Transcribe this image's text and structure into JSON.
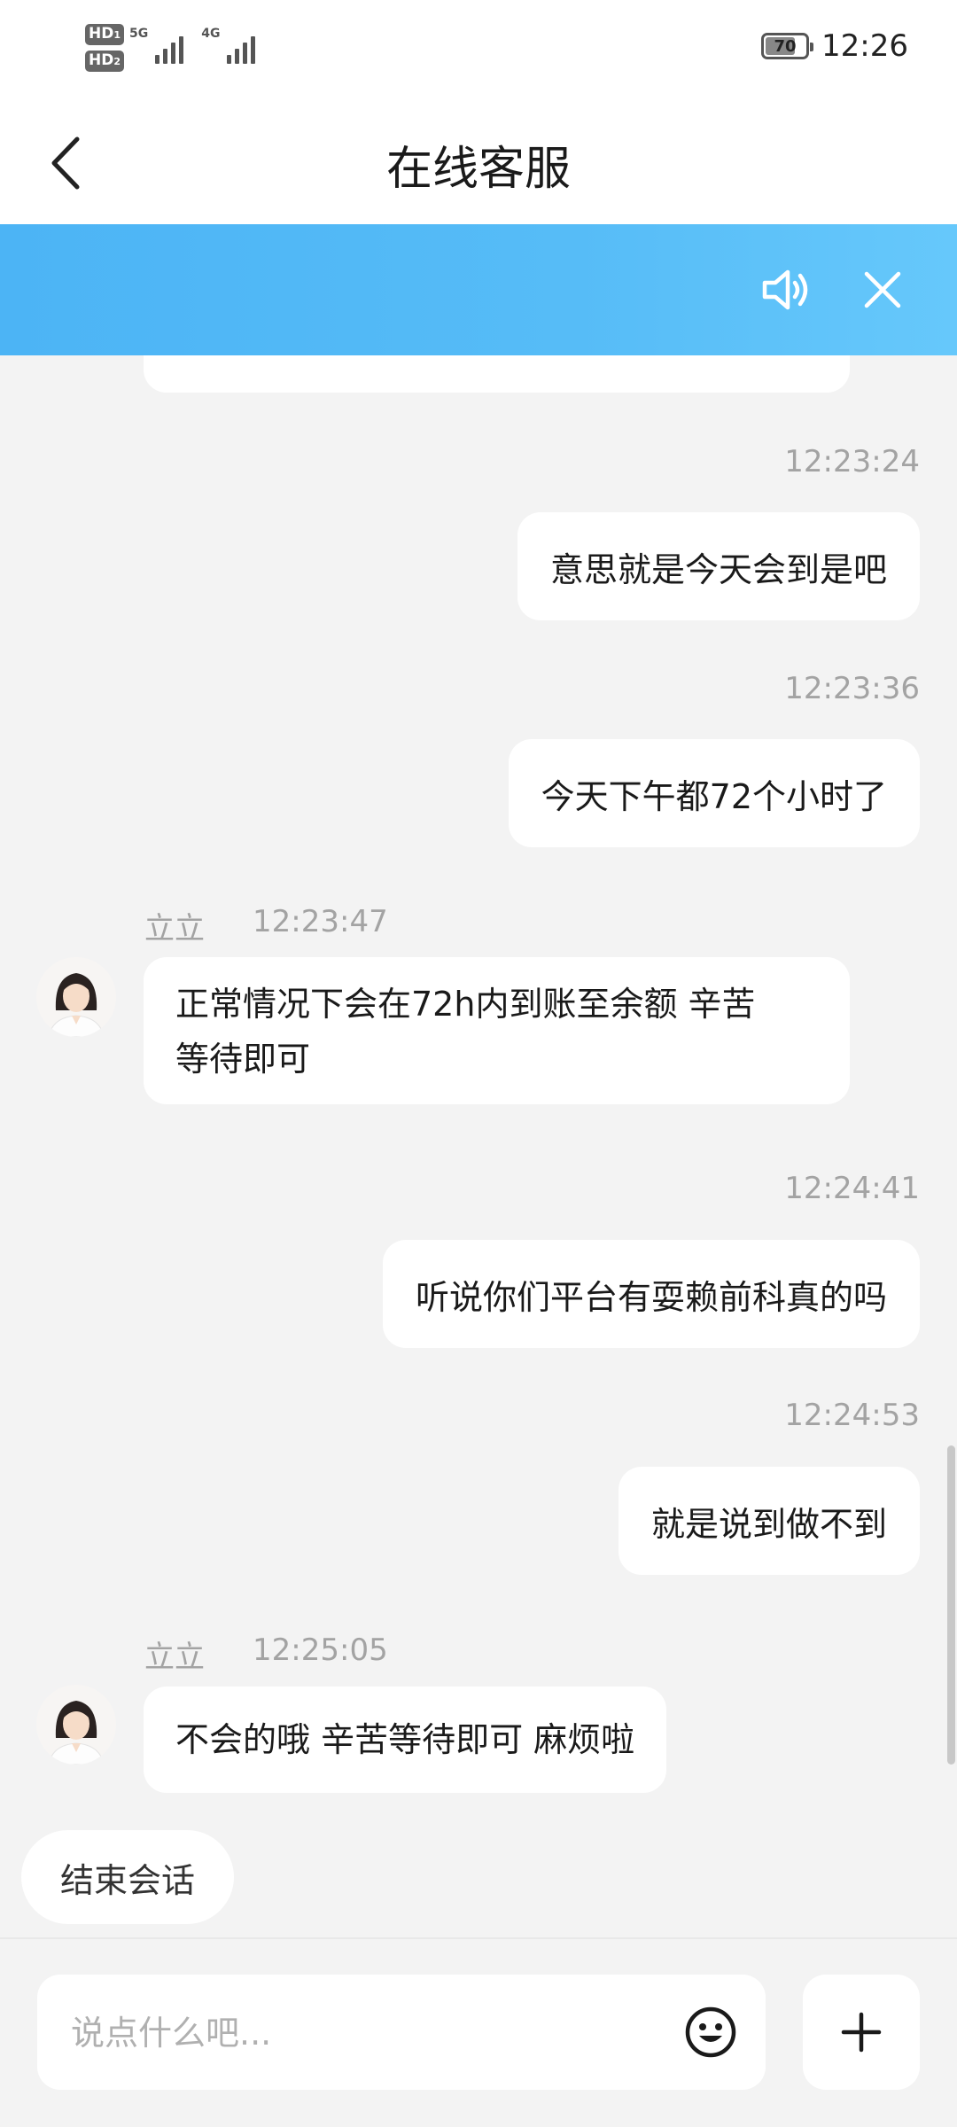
{
  "status_bar": {
    "sim1": "HD",
    "sim1_index": "1",
    "sim2": "HD",
    "sim2_index": "2",
    "network_1": "5G",
    "network_2": "4G",
    "battery": "70",
    "time": "12:26"
  },
  "header": {
    "title": "在线客服"
  },
  "banner": {
    "speaker_icon": "speaker-icon",
    "close_icon": "close-icon"
  },
  "messages": [
    {
      "sender": "user",
      "time": "12:23:24",
      "text": "意思就是今天会到是吧"
    },
    {
      "sender": "user",
      "time": "12:23:36",
      "text": "今天下午都72个小时了"
    },
    {
      "sender": "agent",
      "name": "立立",
      "time": "12:23:47",
      "lines": [
        "正常情况下会在72h内到账至余额 辛苦",
        "等待即可"
      ]
    },
    {
      "sender": "user",
      "time": "12:24:41",
      "text": "听说你们平台有耍赖前科真的吗"
    },
    {
      "sender": "user",
      "time": "12:24:53",
      "text": "就是说到做不到"
    },
    {
      "sender": "agent",
      "name": "立立",
      "time": "12:25:05",
      "lines": [
        "不会的哦 辛苦等待即可 麻烦啦"
      ]
    }
  ],
  "actions": {
    "end_session": "结束会话"
  },
  "composer": {
    "placeholder": "说点什么吧...",
    "emoji_icon": "emoji-icon",
    "add_icon": "plus-icon"
  },
  "colors": {
    "banner_gradient_start": "#4cb4f5",
    "banner_gradient_end": "#66c8fb",
    "background": "#f3f3f3",
    "timestamp": "#a3a3a3"
  }
}
